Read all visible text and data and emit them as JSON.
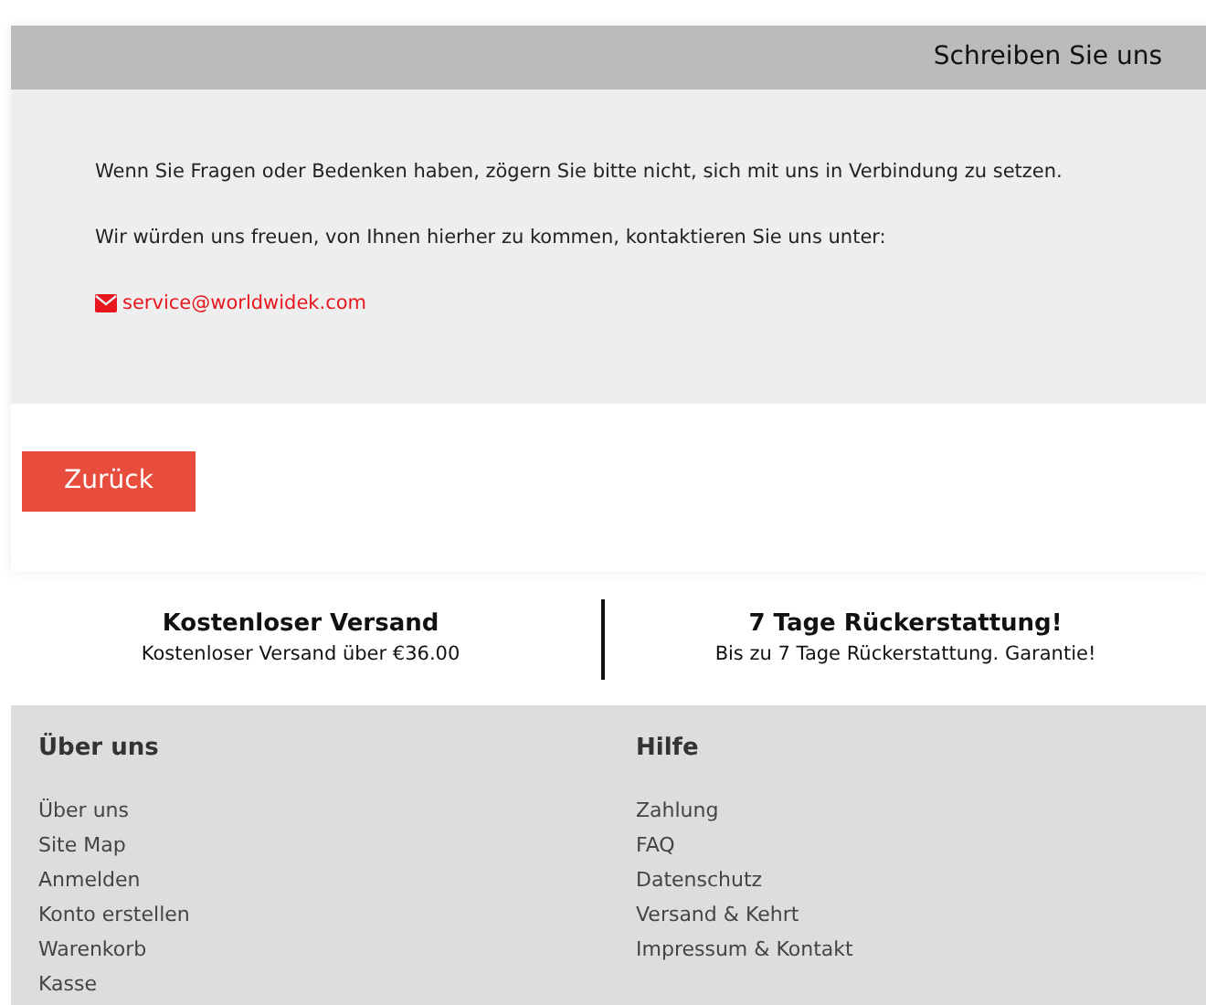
{
  "header": {
    "title": "Schreiben Sie uns"
  },
  "message": {
    "paragraphs": [
      "Wenn Sie Fragen oder Bedenken haben, zögern Sie bitte nicht, sich mit uns in Verbindung zu setzen.",
      "Wir würden uns freuen, von Ihnen hierher zu kommen, kontaktieren Sie uns unter:"
    ],
    "email": "service@worldwidek.com"
  },
  "back_button": {
    "label": "Zurück"
  },
  "features": [
    {
      "title": "Kostenloser Versand",
      "text": "Kostenloser Versand über €36.00"
    },
    {
      "title": "7 Tage Rückerstattung!",
      "text": "Bis zu 7 Tage Rückerstattung. Garantie!"
    }
  ],
  "footer": {
    "columns": [
      {
        "heading": "Über uns",
        "links": [
          "Über uns",
          "Site Map",
          "Anmelden",
          "Konto erstellen",
          "Warenkorb",
          "Kasse"
        ]
      },
      {
        "heading": "Hilfe",
        "links": [
          "Zahlung",
          "FAQ",
          "Datenschutz",
          "Versand & Kehrt",
          "Impressum & Kontakt"
        ]
      }
    ]
  }
}
